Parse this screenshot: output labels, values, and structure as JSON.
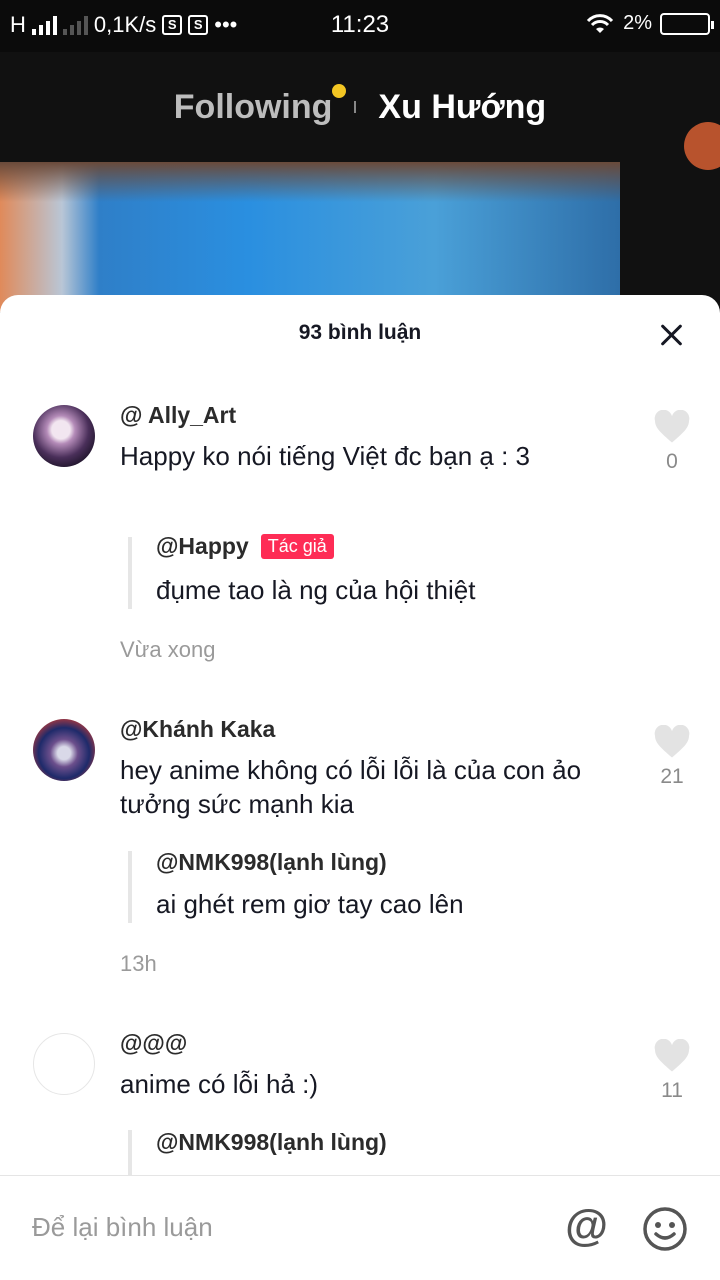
{
  "status_bar": {
    "network_type": "H",
    "speed": "0,1K/s",
    "notif_icons": [
      "S",
      "S"
    ],
    "more": "•••",
    "time": "11:23",
    "battery": "2%"
  },
  "top_tabs": {
    "following": "Following",
    "trending": "Xu Hướng"
  },
  "comments_panel": {
    "title": "93 bình luận",
    "comments": [
      {
        "username": "@ Ally_Art",
        "text": "Happy ko nói tiếng Việt đc bạn ạ : 3",
        "likes": "0",
        "reply": {
          "username": "@Happy",
          "badge": "Tác giả",
          "text": "đụme tao là ng của hội thiệt"
        },
        "time": "Vừa xong"
      },
      {
        "username": "@Khánh Kaka",
        "text": "hey anime không có lỗi lỗi là của con ảo tưởng sức mạnh kia",
        "likes": "21",
        "reply": {
          "username": "@NMK998(lạnh lùng)",
          "text": "ai ghét rem giơ tay cao lên"
        },
        "time": "13h"
      },
      {
        "username": "@@@",
        "text": "anime có lỗi hả :)",
        "likes": "11",
        "reply": {
          "username": "@NMK998(lạnh lùng)"
        }
      }
    ]
  },
  "input_bar": {
    "placeholder": "Để lại bình luận",
    "mention_symbol": "@"
  },
  "colors": {
    "accent_red": "#fe2c55",
    "notification_dot": "#f3c623"
  }
}
